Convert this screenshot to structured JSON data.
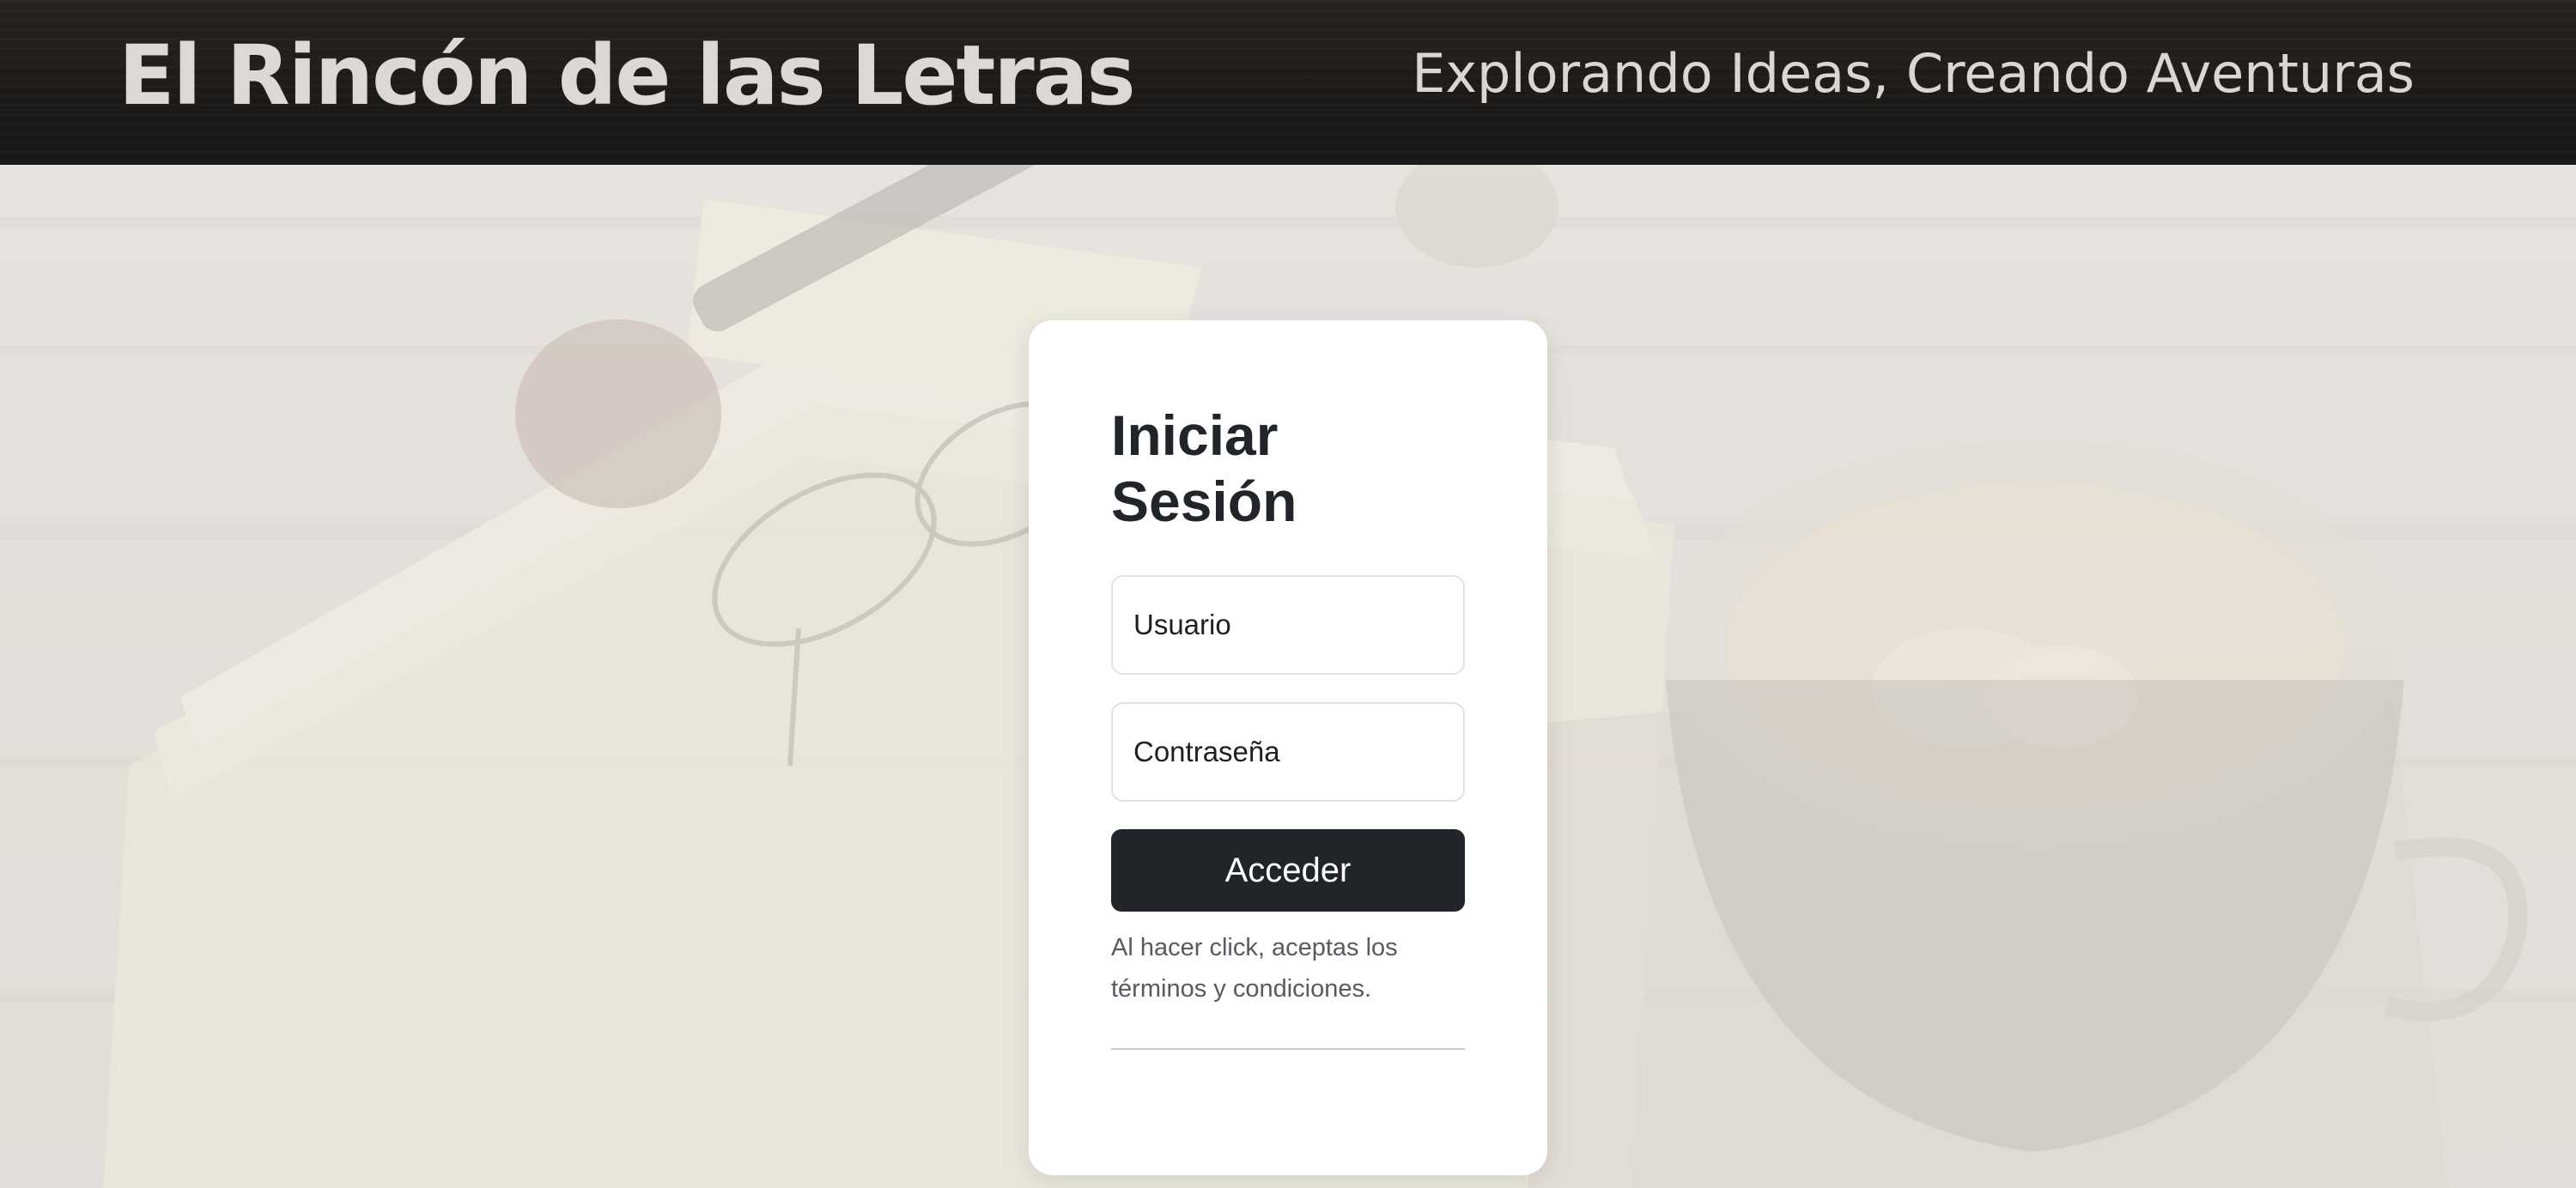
{
  "header": {
    "site_title": "El Rincón de las Letras",
    "tagline": "Explorando Ideas, Creando Aventuras"
  },
  "login": {
    "title": "Iniciar Sesión",
    "username_placeholder": "Usuario",
    "password_placeholder": "Contraseña",
    "submit_label": "Acceder",
    "terms_text": "Al hacer click, aceptas los términos y condiciones."
  }
}
